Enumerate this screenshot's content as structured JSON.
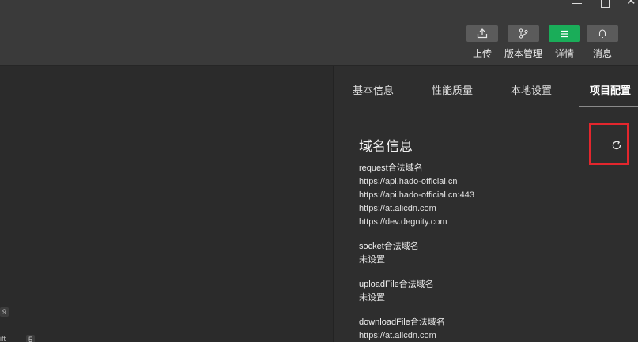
{
  "toolbar": {
    "buttons": [
      {
        "label": "上传",
        "icon": "upload-icon"
      },
      {
        "label": "版本管理",
        "icon": "branch-icon"
      },
      {
        "label": "详情",
        "icon": "menu-icon"
      },
      {
        "label": "消息",
        "icon": "bell-icon"
      }
    ],
    "accent_color": "#1aad59"
  },
  "left_pane": {
    "badges": [
      "9",
      "5"
    ],
    "partial_text": "ift"
  },
  "panel": {
    "tabs": [
      "基本信息",
      "性能质量",
      "本地设置",
      "项目配置"
    ],
    "active_tab": "项目配置",
    "section_title": "域名信息",
    "groups": [
      {
        "label": "request合法域名",
        "values": [
          "https://api.hado-official.cn",
          "https://api.hado-official.cn:443",
          "https://at.alicdn.com",
          "https://dev.degnity.com"
        ]
      },
      {
        "label": "socket合法域名",
        "values": [
          "未设置"
        ]
      },
      {
        "label": "uploadFile合法域名",
        "values": [
          "未设置"
        ]
      },
      {
        "label": "downloadFile合法域名",
        "values": [
          "https://at.alicdn.com"
        ]
      }
    ],
    "highlight_color": "#e3262d"
  }
}
